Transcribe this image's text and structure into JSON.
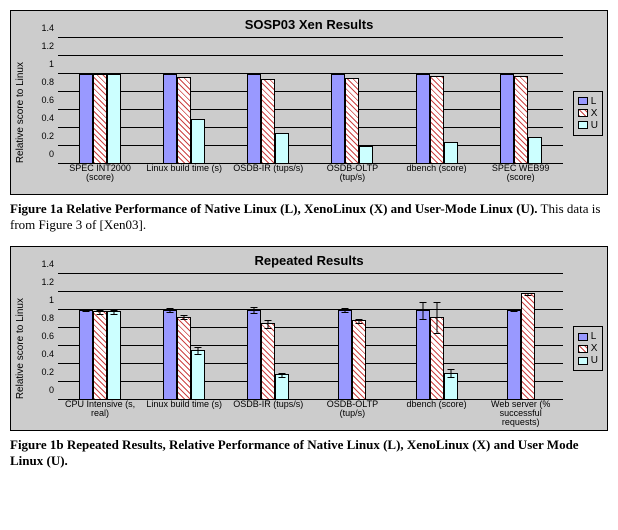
{
  "chart_data": [
    {
      "id": "a",
      "type": "bar",
      "title": "SOSP03 Xen Results",
      "ylabel": "Relative score to Linux",
      "ylim": [
        0,
        1.4
      ],
      "yticks": [
        0,
        0.2,
        0.4,
        0.6,
        0.8,
        1,
        1.2,
        1.4
      ],
      "categories": [
        "SPEC INT2000 (score)",
        "Linux build time (s)",
        "OSDB-IR (tups/s)",
        "OSDB-OLTP (tup/s)",
        "dbench (score)",
        "SPEC WEB99 (score)"
      ],
      "legend": [
        "L",
        "X",
        "U"
      ],
      "series": [
        {
          "name": "L",
          "values": [
            1.0,
            1.0,
            1.0,
            1.0,
            1.0,
            1.0
          ]
        },
        {
          "name": "X",
          "values": [
            1.0,
            0.97,
            0.95,
            0.96,
            0.98,
            0.98
          ]
        },
        {
          "name": "U",
          "values": [
            1.0,
            0.5,
            0.35,
            0.2,
            0.25,
            0.3
          ]
        }
      ]
    },
    {
      "id": "b",
      "type": "bar",
      "title": "Repeated Results",
      "ylabel": "Relative score to Linux",
      "ylim": [
        0,
        1.4
      ],
      "yticks": [
        0,
        0.2,
        0.4,
        0.6,
        0.8,
        1,
        1.2,
        1.4
      ],
      "categories": [
        "CPU Intensive (s, real)",
        "Linux build time (s)",
        "OSDB-IR (tups/s)",
        "OSDB-OLTP (tup/s)",
        "dbench (score)",
        "Web server (% successful requests)"
      ],
      "legend": [
        "L",
        "X",
        "U"
      ],
      "series": [
        {
          "name": "L",
          "values": [
            1.0,
            1.0,
            1.0,
            1.0,
            1.0,
            1.0
          ]
        },
        {
          "name": "X",
          "values": [
            0.98,
            0.92,
            0.85,
            0.88,
            0.92,
            1.18
          ]
        },
        {
          "name": "U",
          "values": [
            0.98,
            0.55,
            0.28,
            null,
            0.3,
            null
          ]
        }
      ],
      "error_bars": {
        "L": [
          0.02,
          0.03,
          0.04,
          0.03,
          0.1,
          0.02
        ],
        "X": [
          0.03,
          0.03,
          0.05,
          0.03,
          0.18,
          0.02
        ],
        "U": [
          0.03,
          0.04,
          0.03,
          null,
          0.05,
          null
        ]
      }
    }
  ],
  "captions": {
    "a_bold": "Figure 1a Relative Performance of Native Linux (L), XenoLinux (X) and User-Mode Linux (U).",
    "a_rest": " This data is from Figure 3 of [Xen03].",
    "b_bold": "Figure 1b Repeated Results, Relative Performance of Native Linux (L), XenoLinux (X) and User Mode Linux (U)."
  }
}
